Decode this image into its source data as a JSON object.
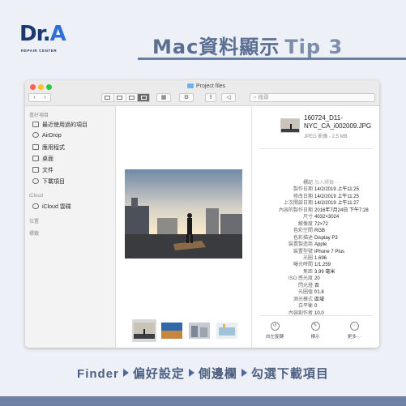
{
  "header": {
    "logo_text": "Dr.",
    "logo_accent": "A",
    "logo_subtitle": "REPAIR CENTER",
    "title": "Mac資料顯示",
    "tip": "Tip 3"
  },
  "window": {
    "title": "Project files",
    "toolbar": {
      "back_label": "‹",
      "forward_label": "›",
      "search_placeholder": "搜尋",
      "active_view": "gallery"
    },
    "sidebar": {
      "favorites_header": "喜好項目",
      "favorites": [
        {
          "label": "最近使用過的項目",
          "icon": "recents-icon"
        },
        {
          "label": "AirDrop",
          "icon": "airdrop-icon"
        },
        {
          "label": "應用程式",
          "icon": "applications-icon"
        },
        {
          "label": "桌面",
          "icon": "desktop-icon"
        },
        {
          "label": "文件",
          "icon": "documents-icon"
        },
        {
          "label": "下載項目",
          "icon": "downloads-icon"
        }
      ],
      "icloud_header": "iCloud",
      "icloud": [
        {
          "label": "iCloud 雲碟",
          "icon": "icloud-drive-icon"
        }
      ],
      "locations_header": "位置",
      "tags_header": "標籤"
    },
    "info": {
      "file_name_line1": "160724_D11-",
      "file_name_line2": "NYC_CA_i002009.JPG",
      "file_kind": "JPEG 影像 - 2.5 MB",
      "rows": [
        {
          "key": "標記",
          "value": "加入標籤⋯"
        },
        {
          "key": "製作日期",
          "value": "14/2/2019 上午11:25"
        },
        {
          "key": "修改日期",
          "value": "14/2/2019 上午11:25"
        },
        {
          "key": "上次開啟日期",
          "value": "14/2/2019 上午11:27"
        },
        {
          "key": "內容的製作日期",
          "value": "2016年7月24日 下午7:28"
        },
        {
          "key": "尺寸",
          "value": "4032×3024"
        },
        {
          "key": "解像度",
          "value": "72×72"
        },
        {
          "key": "色彩空間",
          "value": "RGB"
        },
        {
          "key": "色彩描述",
          "value": "Display P3"
        },
        {
          "key": "裝置製造商",
          "value": "Apple"
        },
        {
          "key": "裝置型號",
          "value": "iPhone 7 Plus"
        },
        {
          "key": "光圈",
          "value": "1.696"
        },
        {
          "key": "曝光時間",
          "value": "1/1,259"
        },
        {
          "key": "焦距",
          "value": "3.99 毫米"
        },
        {
          "key": "ISO 感光度",
          "value": "20"
        },
        {
          "key": "閃光燈",
          "value": "否"
        },
        {
          "key": "光圈值",
          "value": "f/1.8"
        },
        {
          "key": "測光模式",
          "value": "區域"
        },
        {
          "key": "白平衡",
          "value": "0"
        },
        {
          "key": "內容創作者",
          "value": "10.0"
        }
      ],
      "actions": [
        {
          "label": "向左旋轉",
          "glyph": "↺"
        },
        {
          "label": "標示",
          "glyph": "✎"
        },
        {
          "label": "更多⋯",
          "glyph": "⋯"
        }
      ]
    }
  },
  "footer": {
    "step1": "Finder",
    "step2": "偏好設定",
    "step3": "側邊欄",
    "step4": "勾選下載項目"
  },
  "colors": {
    "brand_blue": "#1a3a6b",
    "accent_blue": "#2f6fd6",
    "title_gray_blue": "#5b6f93",
    "bar_blue": "#6f82a5"
  }
}
